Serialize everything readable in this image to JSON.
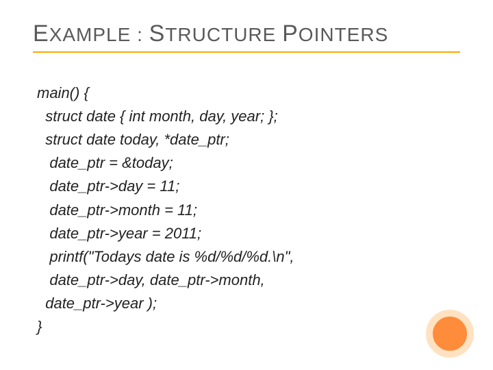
{
  "title": {
    "e1": "E",
    "xample": "XAMPLE",
    "colon": " : ",
    "s": "S",
    "tructure": "TRUCTURE",
    "space": " ",
    "p": "P",
    "ointers": "OINTERS"
  },
  "code": {
    "l1": "main() {",
    "l2": "  struct date { int month, day, year; };",
    "l3": "  struct date today, *date_ptr;",
    "l4": "   date_ptr = &today;",
    "l5": "   date_ptr->day = 11;",
    "l6": "   date_ptr->month = 11;",
    "l7": "   date_ptr->year = 2011;",
    "l8": "   printf(\"Todays date is %d/%d/%d.\\n\",",
    "l9": "   date_ptr->day, date_ptr->month,",
    "l10": "  date_ptr->year );",
    "l11": "}"
  }
}
